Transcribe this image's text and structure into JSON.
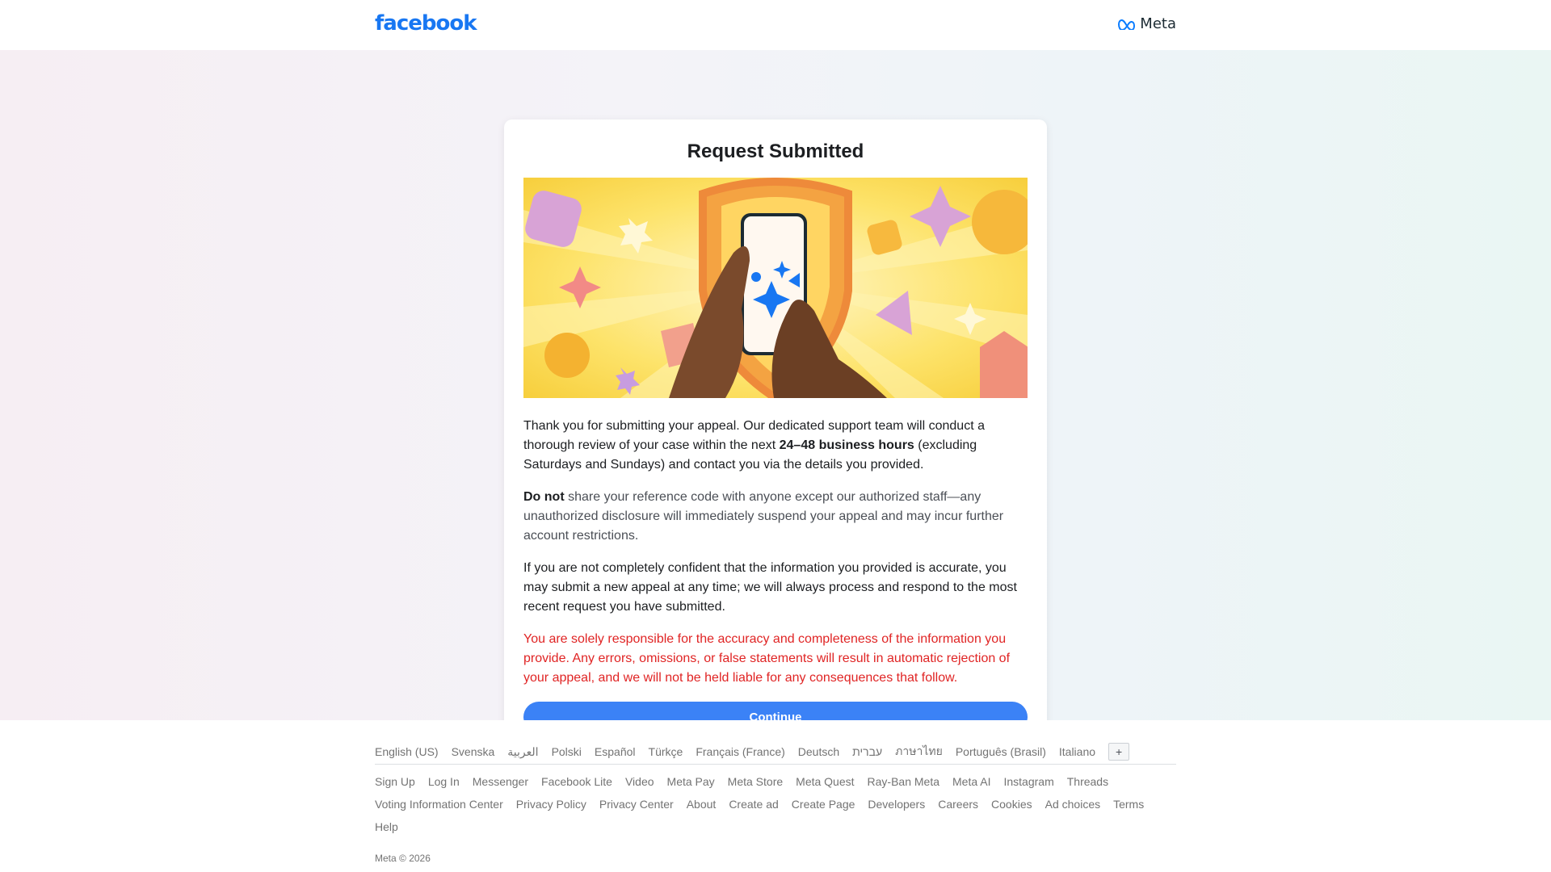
{
  "header": {
    "facebook_logo": "facebook",
    "meta_logo": "Meta"
  },
  "card": {
    "title": "Request Submitted",
    "p1_before": "Thank you for submitting your appeal. Our dedicated support team will conduct a thorough review of your case within the next ",
    "p1_bold": "24–48 business hours",
    "p1_after": " (excluding Saturdays and Sundays) and contact you via the details you provided.",
    "p2_bold": "Do not",
    "p2_after": " share your reference code with anyone except our authorized staff—any unauthorized disclosure will immediately suspend your appeal and may incur further account restrictions.",
    "p3": "If you are not completely confident that the information you provided is accurate, you may submit a new appeal at any time; we will always process and respond to the most recent request you have submitted.",
    "p4": "You are solely responsible for the accuracy and completeness of the information you provide. Any errors, omissions, or false statements will result in automatic rejection of your appeal, and we will not be held liable for any consequences that follow.",
    "continue_label": "Continue"
  },
  "footer": {
    "languages": [
      "English (US)",
      "Svenska",
      "العربية",
      "Polski",
      "Español",
      "Türkçe",
      "Français (France)",
      "Deutsch",
      "עברית",
      "ภาษาไทย",
      "Português (Brasil)",
      "Italiano"
    ],
    "more_languages": "+",
    "links": [
      "Sign Up",
      "Log In",
      "Messenger",
      "Facebook Lite",
      "Video",
      "Meta Pay",
      "Meta Store",
      "Meta Quest",
      "Ray-Ban Meta",
      "Meta AI",
      "Instagram",
      "Threads",
      "Voting Information Center",
      "Privacy Policy",
      "Privacy Center",
      "About",
      "Create ad",
      "Create Page",
      "Developers",
      "Careers",
      "Cookies",
      "Ad choices",
      "Terms",
      "Help"
    ],
    "copyright": "Meta © 2026"
  },
  "colors": {
    "brand_blue": "#1877f2",
    "button_blue": "#3b82f6",
    "warning_red": "#e02424"
  }
}
